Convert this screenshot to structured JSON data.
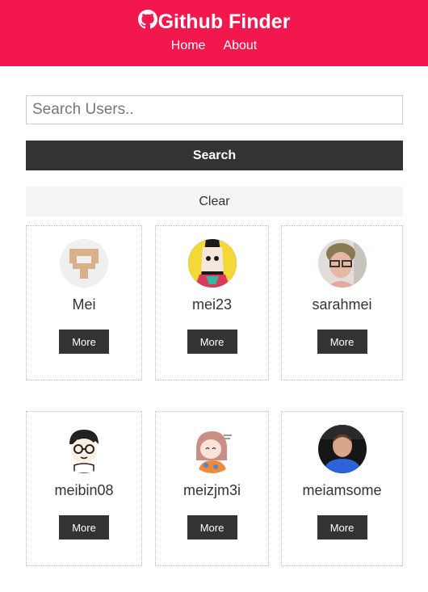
{
  "app": {
    "title": "Github Finder",
    "brand_icon": "github-icon"
  },
  "nav": {
    "links": [
      "Home",
      "About"
    ]
  },
  "search": {
    "placeholder": "Search Users..",
    "value": "",
    "submit_label": "Search",
    "clear_label": "Clear"
  },
  "users": [
    {
      "login": "Mei",
      "more_label": "More",
      "avatar": "identicon-avatar"
    },
    {
      "login": "mei23",
      "more_label": "More",
      "avatar": "anime-avatar"
    },
    {
      "login": "sarahmei",
      "more_label": "More",
      "avatar": "photo-avatar"
    },
    {
      "login": "meibin08",
      "more_label": "More",
      "avatar": "cartoon-avatar"
    },
    {
      "login": "meizjm3i",
      "more_label": "More",
      "avatar": "illustration-avatar"
    },
    {
      "login": "meiamsome",
      "more_label": "More",
      "avatar": "photo-avatar"
    }
  ],
  "colors": {
    "navbar": "#f2174c",
    "dark_button": "#333333",
    "light_button": "#f4f4f4",
    "text": "#333333"
  }
}
